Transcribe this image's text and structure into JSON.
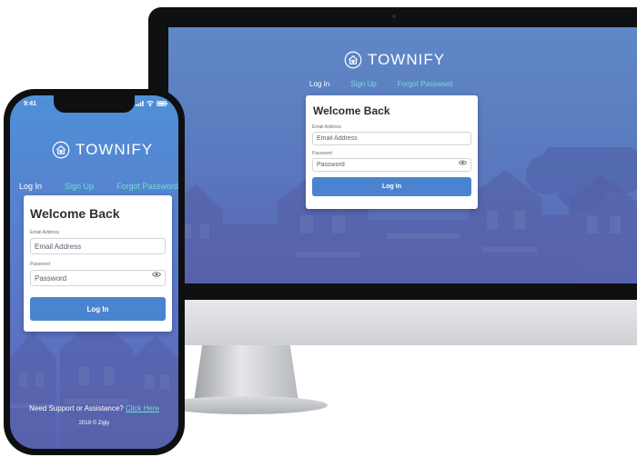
{
  "brand": {
    "name": "TOWNIFY",
    "icon": "house-heart-icon"
  },
  "tabs": [
    {
      "label": "Log In",
      "active": true
    },
    {
      "label": "Sign Up",
      "active": false
    },
    {
      "label": "Forgot Password",
      "active": false
    }
  ],
  "login": {
    "heading": "Welcome Back",
    "email_label": "Email Address",
    "email_placeholder": "Email Address",
    "password_label": "Password",
    "password_placeholder": "Password",
    "show_password_icon": "eye-icon",
    "submit_label": "Log In"
  },
  "phone": {
    "status_time": "9:41",
    "status_icons": [
      "signal-icon",
      "wifi-icon",
      "battery-icon"
    ],
    "support_text": "Need Support or Assistance?",
    "support_link": "Click Here",
    "copyright": "2019 © Zigly"
  },
  "colors": {
    "accent": "#4a84d0",
    "tab_inactive": "#6fe0d2",
    "screen_top": "#5f88c8",
    "screen_bottom": "#5b63b3"
  }
}
